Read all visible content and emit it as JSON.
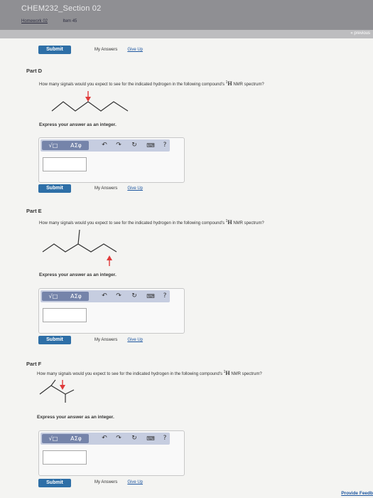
{
  "header": {
    "course_title": "CHEM232_Section 02",
    "breadcrumb": {
      "homework": "Homework 02",
      "item": "Item 45"
    },
    "previous": "« previous"
  },
  "top_actions": {
    "submit": "Submit",
    "my_answers": "My Answers",
    "give_up": "Give Up"
  },
  "parts": [
    {
      "label": "Part D",
      "question_prefix": "How many signals would you expect to see for the indicated hydrogen in the following compound's",
      "nmr_sup": "1",
      "nmr_nucleus": "H",
      "question_suffix": "NMR spectrum?",
      "instruction": "Express your answer as an integer.",
      "answer_value": "",
      "submit": "Submit",
      "my_answers": "My Answers",
      "give_up": "Give Up"
    },
    {
      "label": "Part E",
      "question_prefix": "How many signals would you expect to see for the indicated hydrogen in the following compound's",
      "nmr_sup": "1",
      "nmr_nucleus": "H",
      "question_suffix": "NMR spectrum?",
      "instruction": "Express your answer as an integer.",
      "answer_value": "",
      "submit": "Submit",
      "my_answers": "My Answers",
      "give_up": "Give Up"
    },
    {
      "label": "Part F",
      "question_prefix": "How many signals would you expect to see for the indicated hydrogen in the following compound's",
      "nmr_sup": "1",
      "nmr_nucleus": "H",
      "question_suffix": "NMR spectrum?",
      "instruction": "Express your answer as an integer.",
      "answer_value": "",
      "submit": "Submit",
      "my_answers": "My Answers",
      "give_up": "Give Up"
    }
  ],
  "toolbar": {
    "templates": "√□",
    "greek": "ΑΣφ",
    "undo_icon": "undo-icon",
    "redo_icon": "redo-icon",
    "reset_icon": "reset-icon",
    "keyboard_icon": "keyboard-icon",
    "help": "?"
  },
  "footer": {
    "provide_feedback": "Provide Feedb"
  },
  "colors": {
    "arrow": "#e03a3a",
    "submit": "#2e6fa7",
    "toolbar": "#c6cde0",
    "link": "#1d56a0"
  }
}
